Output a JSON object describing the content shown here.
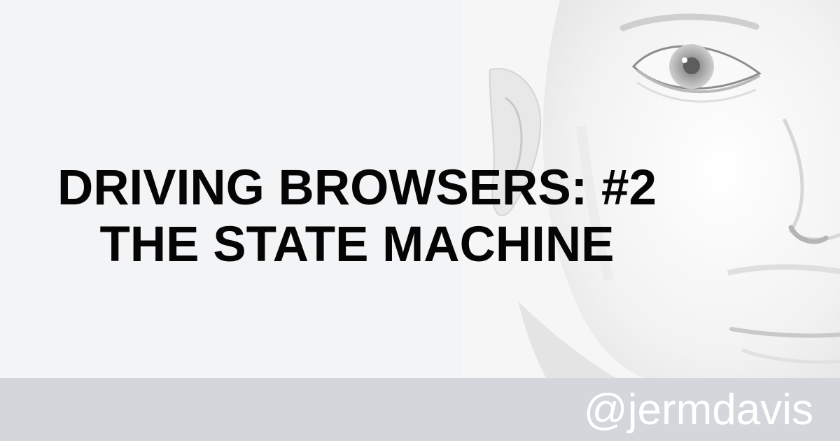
{
  "headline": {
    "line1": "DRIVING BROWSERS: #2",
    "line2": "THE STATE MACHINE"
  },
  "footer": {
    "handle": "@jermdavis"
  },
  "colors": {
    "background": "#f3f4f6",
    "footer_bar": "#d3d6da",
    "headline_text": "#050505",
    "handle_text": "#ffffff"
  }
}
